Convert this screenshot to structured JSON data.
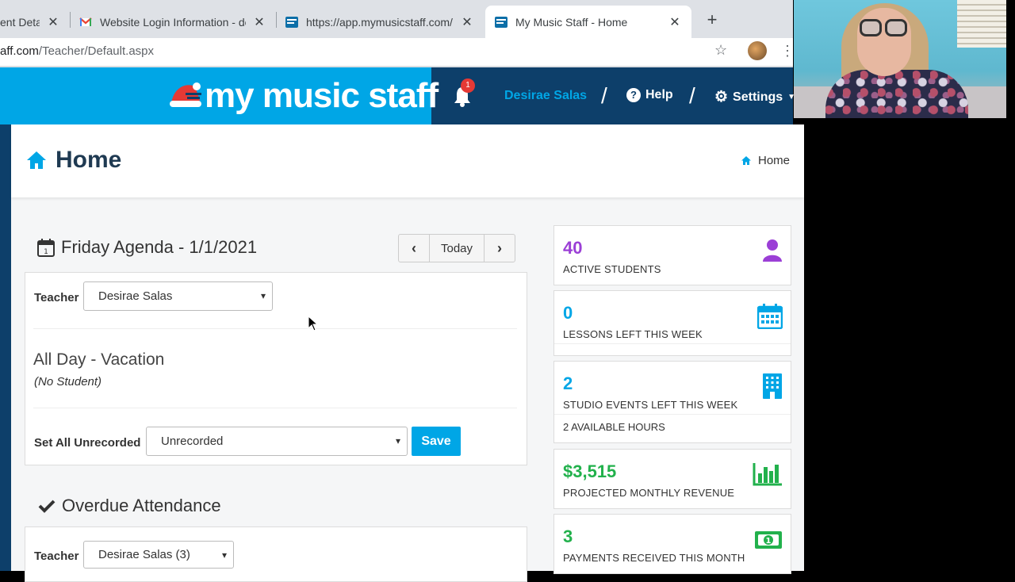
{
  "browser": {
    "tabs": [
      {
        "title": "ent Deta",
        "favicon": "page-icon"
      },
      {
        "title": "Website Login Information - de",
        "favicon": "gmail-icon"
      },
      {
        "title": "https://app.mymusicstaff.com/",
        "favicon": "mms-icon"
      },
      {
        "title": "My Music Staff - Home",
        "favicon": "mms-icon"
      }
    ],
    "new_tab": "+",
    "url_domain": "aff.com",
    "url_path": "/Teacher/Default.aspx"
  },
  "app": {
    "logo_text": "my music staff",
    "notification_count": "1",
    "user_name": "Desirae Salas",
    "help_label": "Help",
    "settings_label": "Settings",
    "colors": {
      "primary": "#00a6e6",
      "navy": "#0d3f6a",
      "purple": "#9b3fd6",
      "green": "#22b14c"
    }
  },
  "page": {
    "title": "Home",
    "breadcrumb": "Home"
  },
  "agenda": {
    "title": "Friday Agenda - 1/1/2021",
    "today_label": "Today",
    "teacher_label": "Teacher",
    "teacher_value": "Desirae Salas",
    "event_title": "All Day - Vacation",
    "event_student": "(No Student)",
    "set_all_label": "Set All Unrecorded",
    "set_all_value": "Unrecorded",
    "save_label": "Save"
  },
  "overdue": {
    "title": "Overdue Attendance",
    "teacher_label": "Teacher",
    "teacher_value": "Desirae Salas (3)"
  },
  "stats": [
    {
      "value": "40",
      "caption": "ACTIVE STUDENTS",
      "icon": "user-icon",
      "color": "#9b3fd6"
    },
    {
      "value": "0",
      "caption": "LESSONS LEFT THIS WEEK",
      "icon": "calendar-icon",
      "color": "#00a6e6"
    },
    {
      "value": "2",
      "caption": "STUDIO EVENTS LEFT THIS WEEK",
      "sub": "2 AVAILABLE HOURS",
      "icon": "building-icon",
      "color": "#00a6e6"
    },
    {
      "value": "$3,515",
      "caption": "PROJECTED MONTHLY REVENUE",
      "icon": "bar-chart-icon",
      "color": "#22b14c"
    },
    {
      "value": "3",
      "caption": "PAYMENTS RECEIVED THIS MONTH",
      "icon": "money-icon",
      "color": "#22b14c"
    }
  ]
}
